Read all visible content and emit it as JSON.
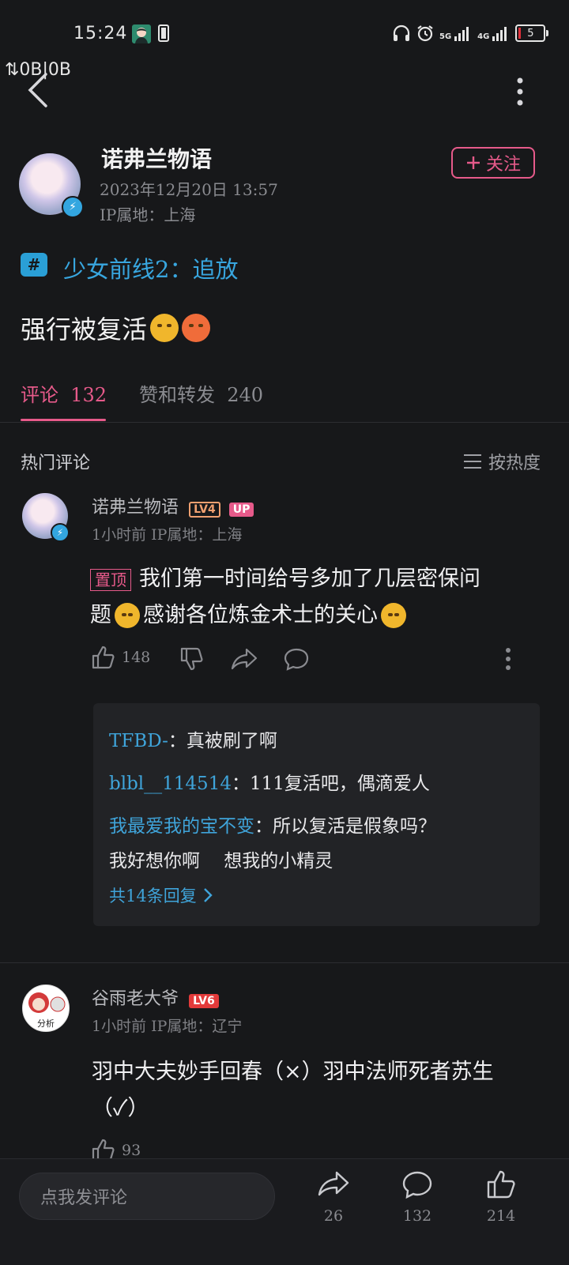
{
  "status_bar": {
    "time": "15:24",
    "net_speed": "⇅0B|0B",
    "sig1": "5G",
    "sig2": "4G",
    "battery": "5"
  },
  "post": {
    "author": "诺弗兰物语",
    "datetime": "2023年12月20日 13:57",
    "ip": "IP属地：上海",
    "follow_label": "关注",
    "topic": "少女前线2：追放",
    "text": "强行被复活"
  },
  "tabs": {
    "comments_label": "评论",
    "comments_count": "132",
    "likes_label": "赞和转发",
    "likes_count": "240"
  },
  "comments_header": {
    "title": "热门评论",
    "sort_label": "按热度"
  },
  "comments": [
    {
      "name": "诺弗兰物语",
      "level": "LV4",
      "badge": "UP",
      "meta": "1小时前 IP属地：上海",
      "pin": "置顶",
      "text_line1": "我们第一时间给号多加了几层密保问",
      "text_line2a": "题",
      "text_line2b": "感谢各位炼金术士的关心",
      "likes": "148",
      "replies": [
        {
          "user": "TFBD-",
          "sep": "：",
          "text": "真被刷了啊"
        },
        {
          "user": "blbl__114514",
          "sep": "：",
          "text": "111复活吧，偶滴爱人"
        },
        {
          "user": "我最爱我的宝不变",
          "sep": "：",
          "text": "所以复活是假象吗？",
          "text2": "我好想你啊　 想我的小精灵"
        }
      ],
      "reply_more": "共14条回复"
    },
    {
      "name": "谷雨老大爷",
      "level": "LV6",
      "avatar_text": "分析",
      "meta": "1小时前 IP属地：辽宁",
      "text_line1": "羽中大夫妙手回春（×）羽中法师死者苏生",
      "text_line2": "（✓）",
      "likes": "93"
    }
  ],
  "bottom": {
    "input_placeholder": "点我发评论",
    "share_count": "26",
    "comment_count": "132",
    "like_count": "214"
  },
  "colors": {
    "background": "#17181a",
    "accent_pink": "#e65a8a",
    "accent_blue": "#38a6df"
  }
}
